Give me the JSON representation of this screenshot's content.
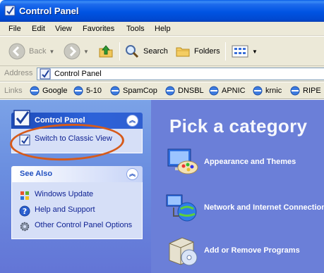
{
  "window": {
    "title": "Control Panel"
  },
  "menu": [
    "File",
    "Edit",
    "View",
    "Favorites",
    "Tools",
    "Help"
  ],
  "toolbar": {
    "back": "Back",
    "search": "Search",
    "folders": "Folders"
  },
  "address": {
    "label": "Address",
    "value": "Control Panel"
  },
  "links": {
    "label": "Links",
    "items": [
      "Google",
      "5-10",
      "SpamCop",
      "DNSBL",
      "APNIC",
      "krnic",
      "RIPE"
    ]
  },
  "left_pane": {
    "control_panel": {
      "title": "Control Panel",
      "task": "Switch to Classic View"
    },
    "see_also": {
      "title": "See Also",
      "items": [
        "Windows Update",
        "Help and Support",
        "Other Control Panel Options"
      ]
    }
  },
  "main": {
    "heading": "Pick a category",
    "categories": [
      "Appearance and Themes",
      "Network and Internet Connections",
      "Add or Remove Programs"
    ]
  },
  "colors": {
    "title_bar": "#0054e3",
    "annotation_oval": "#d65a1a"
  }
}
